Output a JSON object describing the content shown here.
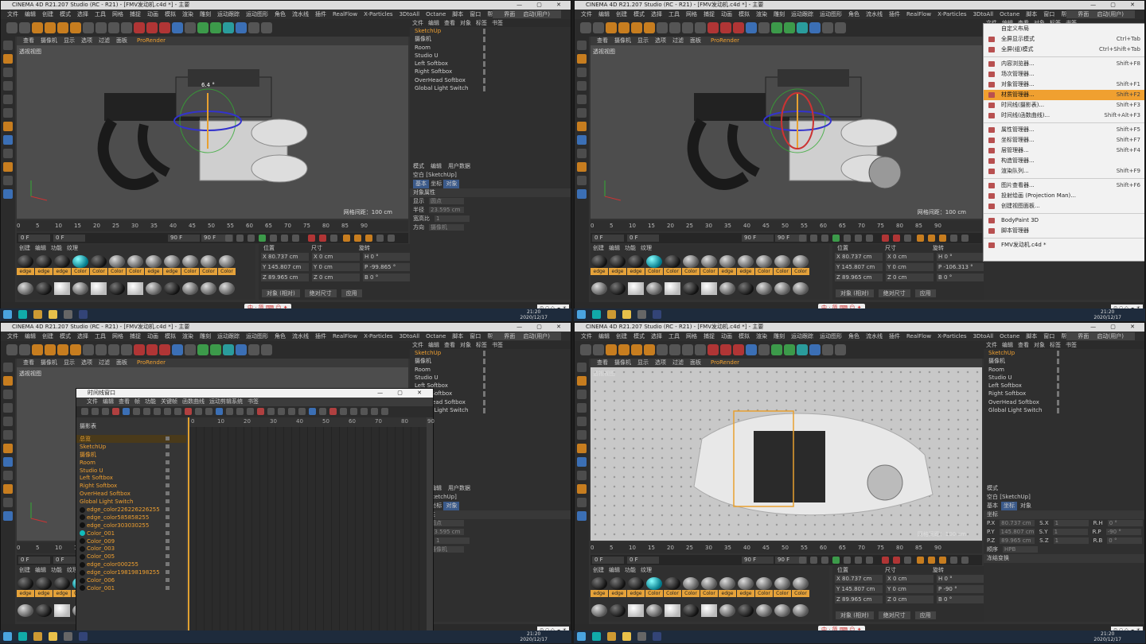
{
  "window_title": "CINEMA 4D R21.207 Studio (RC - R21) - [FMV发动机.c4d *] - 主要",
  "menus": [
    "文件",
    "编辑",
    "创建",
    "模式",
    "选择",
    "工具",
    "网格",
    "捕捉",
    "动画",
    "模拟",
    "渲染",
    "雕刻",
    "运动跟踪",
    "运动图形",
    "角色",
    "流水线",
    "插件",
    "RealFlow",
    "X-Particles",
    "3DtoAll",
    "Octane",
    "脚本",
    "窗口",
    "帮助"
  ],
  "layout_label": "界面",
  "layout_value": "启动(用户)",
  "viewport": {
    "tabs": [
      "查看",
      "摄像机",
      "显示",
      "选项",
      "过滤",
      "面板"
    ],
    "prorender": "ProRender",
    "label": "透视视图",
    "grid_spacing": "网格间距：100 cm",
    "angle_readout": "6.4 °"
  },
  "timeline_ticks": [
    "0",
    "5",
    "10",
    "15",
    "20",
    "25",
    "30",
    "35",
    "40",
    "45",
    "50",
    "55",
    "60",
    "65",
    "70",
    "75",
    "80",
    "85",
    "90"
  ],
  "frames": {
    "current": "0 F",
    "start": "0 F",
    "end": "90 F",
    "end2": "90 F"
  },
  "material_tabs": [
    "创建",
    "编辑",
    "功能",
    "纹理"
  ],
  "materials_row1": [
    {
      "name": "edge",
      "type": "dark"
    },
    {
      "name": "edge",
      "type": "dark"
    },
    {
      "name": "edge",
      "type": "dark"
    },
    {
      "name": "Color",
      "type": "cyan"
    },
    {
      "name": "Color",
      "type": "dark"
    },
    {
      "name": "Color",
      "type": "grey"
    },
    {
      "name": "Color",
      "type": "grey"
    },
    {
      "name": "edge",
      "type": "grey"
    },
    {
      "name": "edge",
      "type": "grey"
    },
    {
      "name": "Color",
      "type": "grey"
    },
    {
      "name": "Color",
      "type": "grey"
    },
    {
      "name": "Color",
      "type": "grey"
    }
  ],
  "materials_row2": [
    "grey",
    "dark",
    "white",
    "grey",
    "white",
    "dark",
    "white",
    "grey",
    "dark",
    "grey",
    "grey",
    "grey"
  ],
  "coords": {
    "headers": [
      "位置",
      "尺寸",
      "旋转"
    ],
    "x": "80.737 cm",
    "y": "145.807 cm",
    "z": "89.965 cm",
    "sx": "0 cm",
    "sy": "0 cm",
    "sz": "0 cm",
    "h": "0 °",
    "p1": "-99.865 °",
    "p2": "-106.313 °",
    "p4": "-90 °",
    "b": "0 °",
    "mode_btn": "对象 (相对)",
    "size_btn": "绝对尺寸",
    "apply_btn": "应用"
  },
  "object_manager": {
    "tabs": [
      "文件",
      "编辑",
      "查看",
      "对象",
      "标签",
      "书签"
    ],
    "items": [
      {
        "name": "SketchUp",
        "active": true
      },
      {
        "name": "摄像机",
        "active": false
      },
      {
        "name": "Room",
        "active": false
      },
      {
        "name": "Studio U",
        "active": false
      },
      {
        "name": "Left Softbox",
        "active": false
      },
      {
        "name": "Right Softbox",
        "active": false
      },
      {
        "name": "OverHead Softbox",
        "active": false
      },
      {
        "name": "Global Light Switch",
        "active": false
      }
    ]
  },
  "attributes": {
    "tabs": [
      "模式",
      "编辑",
      "用户数据"
    ],
    "title": "空白 [SketchUp]",
    "subtabs": [
      "基本",
      "坐标",
      "对象"
    ],
    "section": "对象属性",
    "display_label": "显示",
    "display_value": "圆点",
    "radius_label": "半径",
    "radius_value": "23.595 cm",
    "aspect_label": "宽高比",
    "aspect_value": "1",
    "orient_label": "方向",
    "orient_value": "摄像机"
  },
  "q4_attributes": {
    "title": "空白 [SketchUp]",
    "subtabs": [
      "基本",
      "坐标",
      "对象"
    ],
    "section": "坐标",
    "p_x": "80.737 cm",
    "p_y": "145.807 cm",
    "p_z": "89.965 cm",
    "s_x": "1",
    "s_y": "1",
    "s_z": "1",
    "r_h": "0 °",
    "r_p": "-90 °",
    "r_b": "0 °",
    "order": "顺序",
    "order_val": "HPB",
    "freeze": "冻结变换"
  },
  "context_menu": {
    "header": "自定义布局",
    "items": [
      {
        "label": "全屏显示模式",
        "key": "Ctrl+Tab",
        "sel": false
      },
      {
        "label": "全屏(组)模式",
        "key": "Ctrl+Shift+Tab",
        "sel": false
      },
      {
        "label": "内容浏览器...",
        "key": "Shift+F8",
        "sel": false
      },
      {
        "label": "场次管理器...",
        "key": "",
        "sel": false
      },
      {
        "label": "对象管理器...",
        "key": "Shift+F1",
        "sel": false
      },
      {
        "label": "材质管理器...",
        "key": "Shift+F2",
        "sel": true
      },
      {
        "label": "时间线(摄影表)...",
        "key": "Shift+F3",
        "sel": false
      },
      {
        "label": "时间线(函数曲线)...",
        "key": "Shift+Alt+F3",
        "sel": false
      },
      {
        "label": "属性管理器...",
        "key": "Shift+F5",
        "sel": false
      },
      {
        "label": "坐标管理器...",
        "key": "Shift+F7",
        "sel": false
      },
      {
        "label": "层管理器...",
        "key": "Shift+F4",
        "sel": false
      },
      {
        "label": "构造管理器...",
        "key": "",
        "sel": false
      },
      {
        "label": "渲染队列...",
        "key": "Shift+F9",
        "sel": false
      },
      {
        "label": "图片查看器...",
        "key": "Shift+F6",
        "sel": false
      },
      {
        "label": "投射绘画 (Projection Man)...",
        "key": "",
        "sel": false
      },
      {
        "label": "创建视图面板...",
        "key": "",
        "sel": false
      },
      {
        "label": "BodyPaint 3D",
        "key": "",
        "sel": false
      },
      {
        "label": "脚本管理器",
        "key": "",
        "sel": false
      },
      {
        "label": "FMV发动机.c4d *",
        "key": "",
        "sel": false
      }
    ]
  },
  "timeline_window": {
    "title": "时间线窗口",
    "menus": [
      "文件",
      "编辑",
      "查看",
      "帧",
      "功能",
      "关键帧",
      "函数曲线",
      "运动剪辑系统",
      "书签"
    ],
    "label": "摄影表",
    "rows": [
      {
        "name": "总览",
        "type": "header"
      },
      {
        "name": "SketchUp",
        "type": "obj"
      },
      {
        "name": "摄像机",
        "type": "obj"
      },
      {
        "name": "Room",
        "type": "obj"
      },
      {
        "name": "Studio U",
        "type": "obj"
      },
      {
        "name": "Left Softbox",
        "type": "obj"
      },
      {
        "name": "Right Softbox",
        "type": "obj"
      },
      {
        "name": "OverHead Softbox",
        "type": "obj"
      },
      {
        "name": "Global Light Switch",
        "type": "obj"
      },
      {
        "name": "edge_color226226226255",
        "type": "mat"
      },
      {
        "name": "edge_color585858255",
        "type": "mat"
      },
      {
        "name": "edge_color303030255",
        "type": "mat"
      },
      {
        "name": "Color_001",
        "type": "matc"
      },
      {
        "name": "Color_009",
        "type": "mat"
      },
      {
        "name": "Color_003",
        "type": "mat"
      },
      {
        "name": "Color_005",
        "type": "mat"
      },
      {
        "name": "edge_color000255",
        "type": "mat"
      },
      {
        "name": "edge_color198198198255",
        "type": "mat"
      },
      {
        "name": "Color_006",
        "type": "mat"
      },
      {
        "name": "Color_001",
        "type": "mat"
      }
    ],
    "ruler": [
      "0",
      "10",
      "20",
      "30",
      "40",
      "50",
      "60",
      "70",
      "80",
      "90"
    ],
    "footer": "当前帧  0    预览  0-->90    选择  0-->0"
  },
  "status": {
    "q1": "6.8 °",
    "q4": "00:00:01  旋转：点击并拖动鼠标旋转元素。按住 SHIFT 键量化旋转 / 添加到选择对象；按住 CTRL 键减少选择对象。",
    "clock_time": "21:20",
    "clock_date": "2020/12/17",
    "ime": "中 · 简 ⌨ ☺ ✦",
    "tray": "⊙ ○ ◇ ☁ ☀"
  },
  "colors": {
    "accent": "#f0a030",
    "select": "#3b5a8a",
    "viewport": "#4d4d4d",
    "panel": "#333333"
  }
}
